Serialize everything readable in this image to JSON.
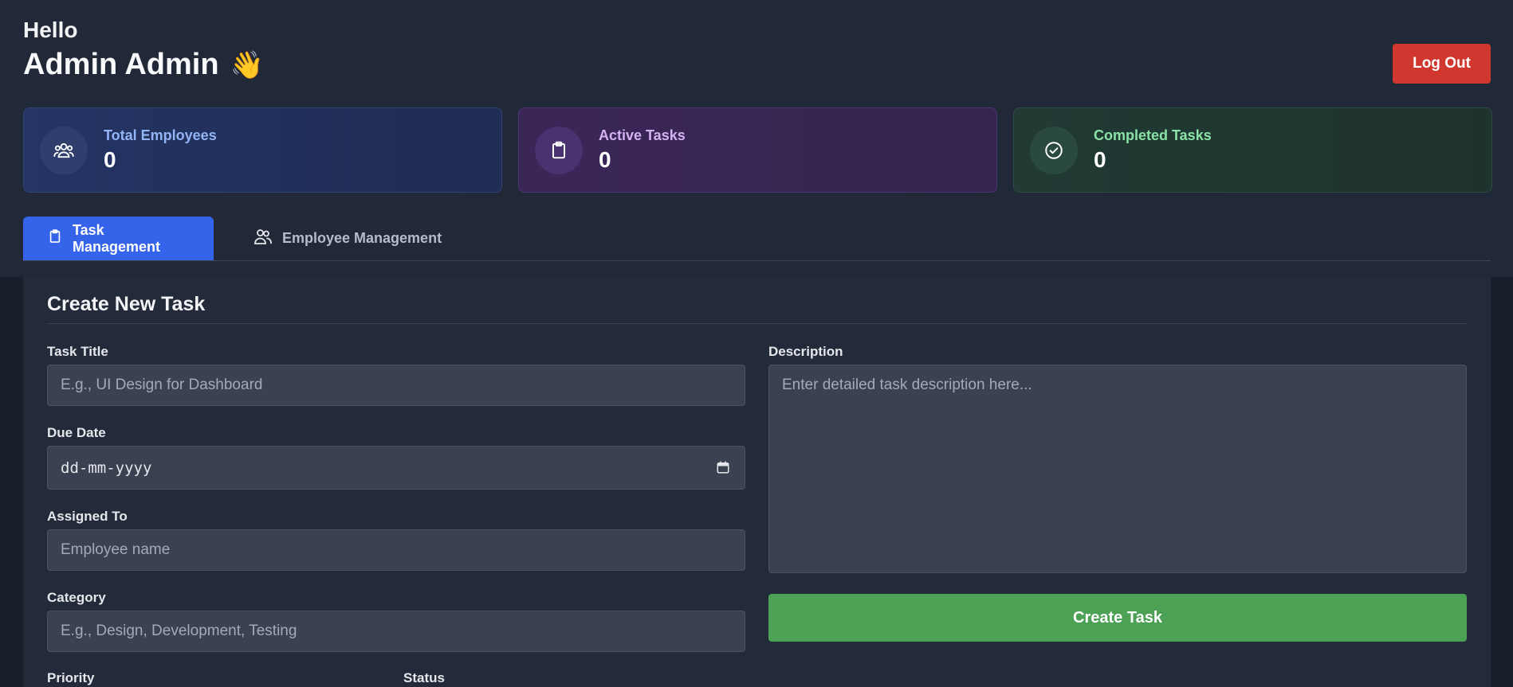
{
  "header": {
    "greeting": "Hello",
    "user_name": "Admin Admin",
    "wave_emoji": "👋",
    "logout_label": "Log Out"
  },
  "stats": [
    {
      "label": "Total Employees",
      "value": "0",
      "icon": "users-icon"
    },
    {
      "label": "Active Tasks",
      "value": "0",
      "icon": "clipboard-icon"
    },
    {
      "label": "Completed Tasks",
      "value": "0",
      "icon": "check-circle-icon"
    }
  ],
  "tabs": [
    {
      "label": "Task Management",
      "icon": "clipboard-icon",
      "active": true
    },
    {
      "label": "Employee Management",
      "icon": "users-icon",
      "active": false
    }
  ],
  "form": {
    "title": "Create New Task",
    "task_title": {
      "label": "Task Title",
      "placeholder": "E.g., UI Design for Dashboard"
    },
    "due_date": {
      "label": "Due Date",
      "placeholder": "dd-mm-yyyy"
    },
    "assigned_to": {
      "label": "Assigned To",
      "placeholder": "Employee name"
    },
    "category": {
      "label": "Category",
      "placeholder": "E.g., Design, Development, Testing"
    },
    "priority": {
      "label": "Priority"
    },
    "status": {
      "label": "Status"
    },
    "description": {
      "label": "Description",
      "placeholder": "Enter detailed task description here..."
    },
    "submit_label": "Create Task"
  },
  "colors": {
    "accent": "#3563e9",
    "danger": "#d0382f",
    "success": "#4da155"
  }
}
